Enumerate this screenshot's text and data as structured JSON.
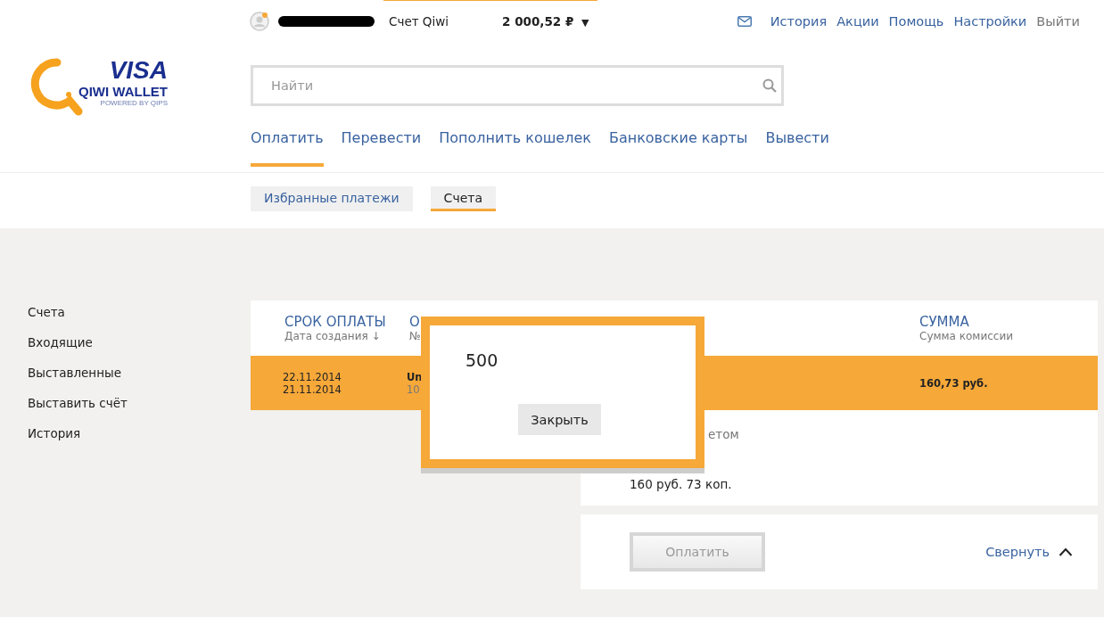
{
  "top_bar": {
    "account_label": "Счет Qiwi",
    "balance": "2 000,52 ₽",
    "balance_caret": "▼",
    "links": [
      {
        "label": "История",
        "kind": "link"
      },
      {
        "label": "Акции",
        "kind": "link"
      },
      {
        "label": "Помощь",
        "kind": "link"
      },
      {
        "label": "Настройки",
        "kind": "link"
      },
      {
        "label": "Выйти",
        "kind": "logout"
      }
    ]
  },
  "logo": {
    "brand": "VISA",
    "name": "QIWI WALLET",
    "tagline": "POWERED BY QIPS"
  },
  "search": {
    "placeholder": "Найти"
  },
  "nav_tabs": [
    {
      "label": "Оплатить",
      "selected": true
    },
    {
      "label": "Перевести",
      "selected": false
    },
    {
      "label": "Пополнить кошелек",
      "selected": false
    },
    {
      "label": "Банковские карты",
      "selected": false
    },
    {
      "label": "Вывести",
      "selected": false
    }
  ],
  "sub_tabs": [
    {
      "label": "Избранные платежи",
      "selected": false
    },
    {
      "label": "Счета",
      "selected": true
    }
  ],
  "sidebar": {
    "items": [
      "Счета",
      "Входящие",
      "Выставленные",
      "Выставить счёт",
      "История"
    ]
  },
  "table": {
    "columns": [
      {
        "title": "СРОК ОПЛАТЫ",
        "subtitle": "Дата создания ↓"
      },
      {
        "title": "О",
        "subtitle": "№"
      },
      {
        "title": "СУММА",
        "subtitle": "Сумма комиссии"
      }
    ],
    "rows": [
      {
        "selected": true,
        "due_date": "22.11.2014",
        "created": "21.11.2014",
        "column_2": "Un",
        "column_2_sub": "10",
        "amount": "160,73 руб."
      }
    ]
  },
  "details": {
    "label": "етом",
    "value": "160 руб. 73 коп."
  },
  "actions": {
    "pay_button": {
      "label": "Оплатить",
      "disabled": true
    },
    "collapse_link": "Свернуть"
  },
  "modal": {
    "text": "500",
    "close_button": "Закрыть"
  }
}
